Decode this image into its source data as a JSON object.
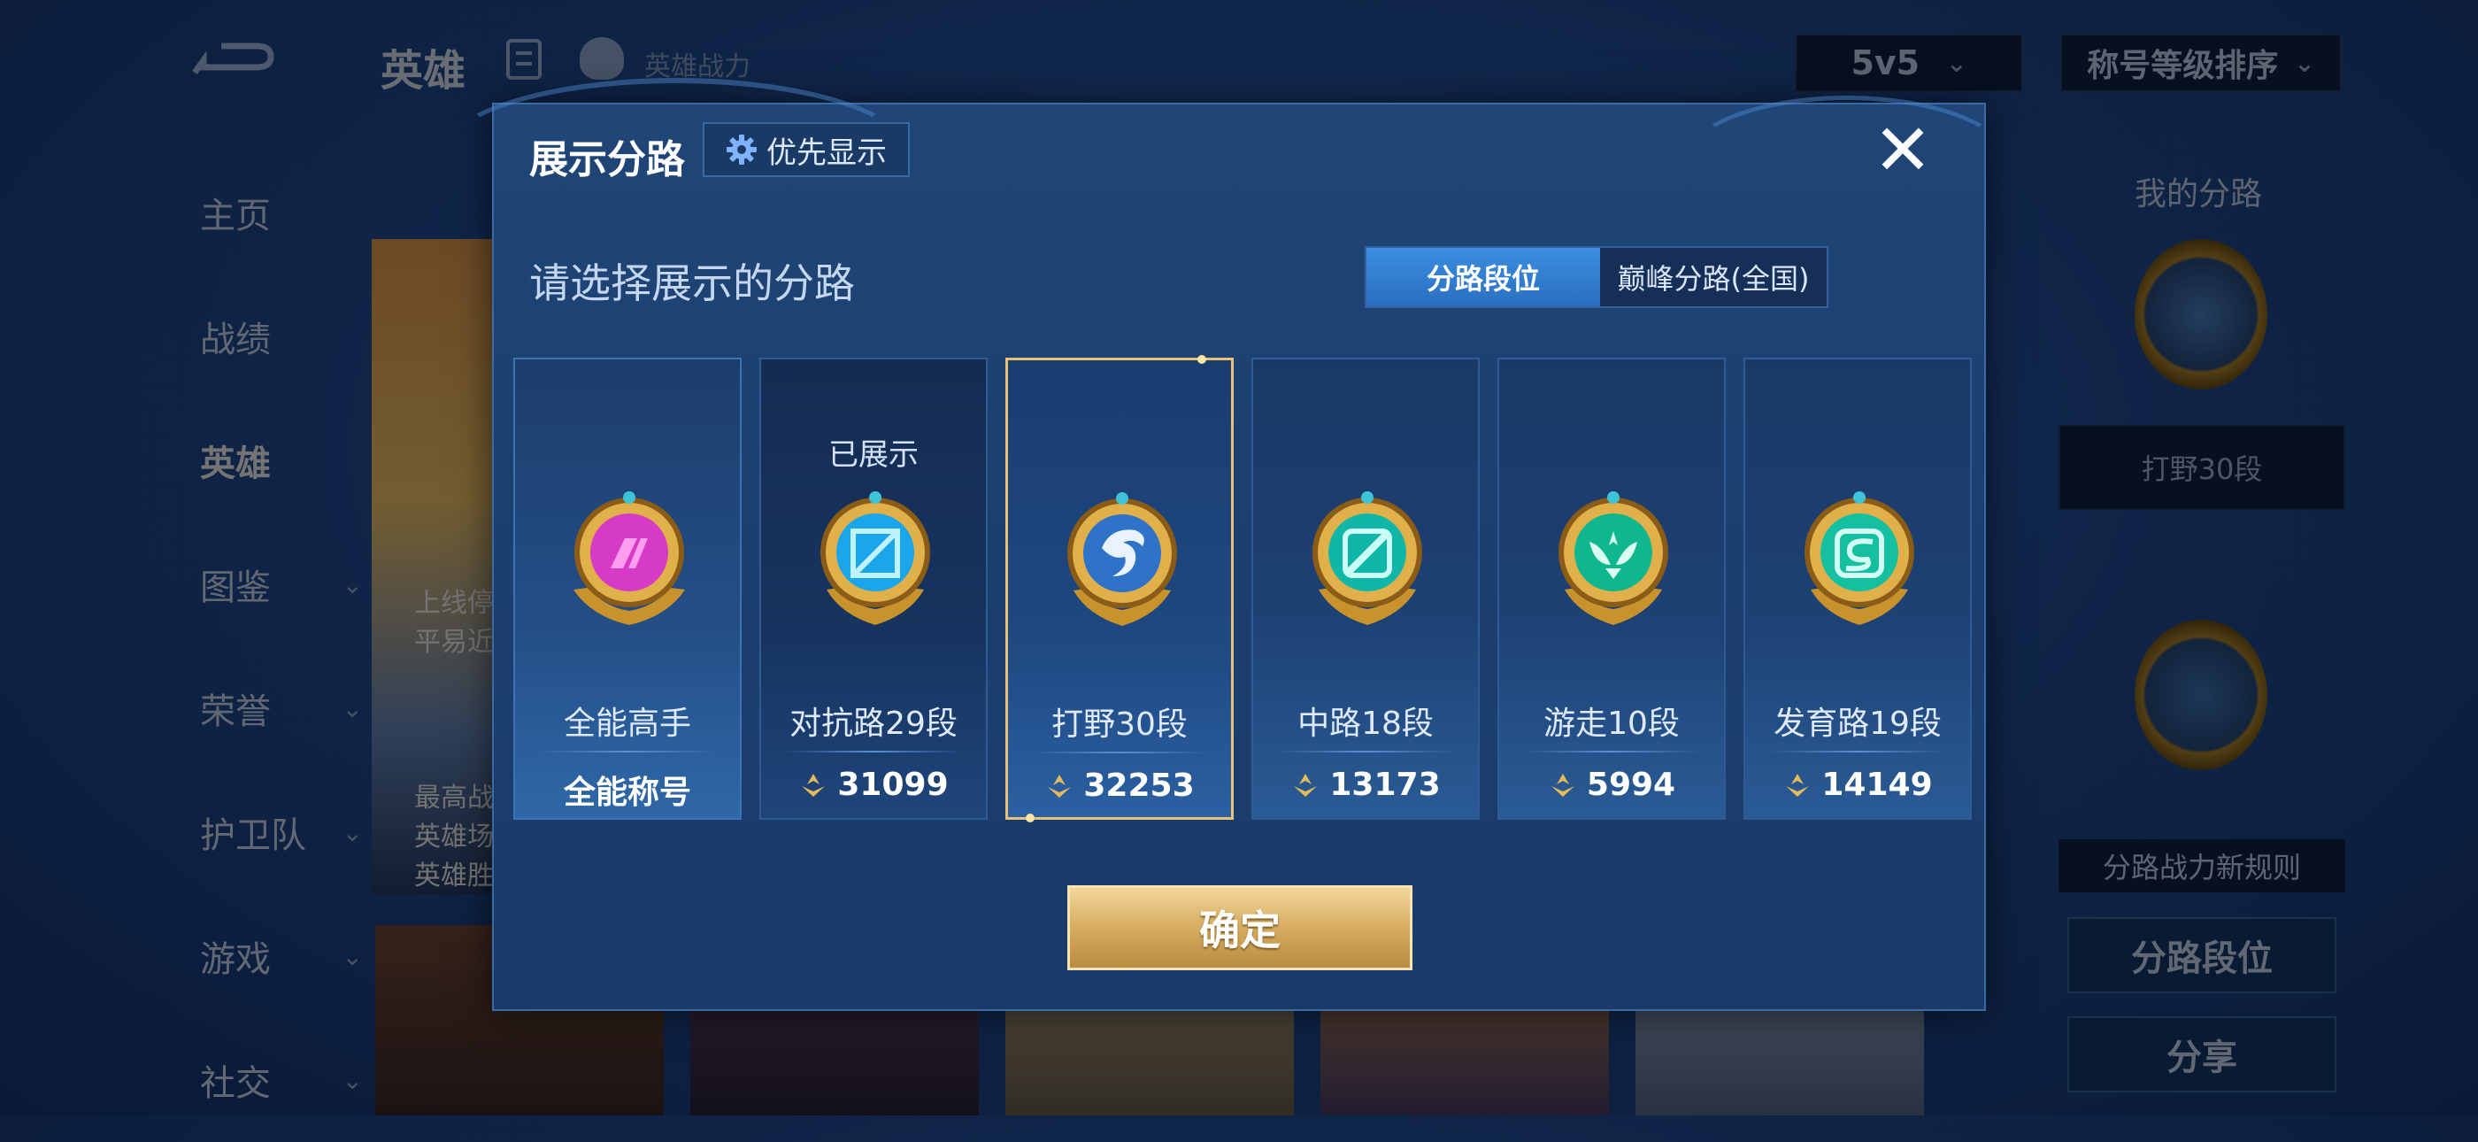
{
  "background": {
    "page_title": "英雄",
    "power_label": "英雄战力",
    "mode_select": "5v5",
    "sort_select": "称号等级排序",
    "nav": [
      {
        "label": "主页",
        "has_chevron": false
      },
      {
        "label": "战绩",
        "has_chevron": false
      },
      {
        "label": "英雄",
        "has_chevron": false,
        "active": true
      },
      {
        "label": "图鉴",
        "has_chevron": true
      },
      {
        "label": "荣誉",
        "has_chevron": true
      },
      {
        "label": "护卫队",
        "has_chevron": true
      },
      {
        "label": "游戏",
        "has_chevron": true
      },
      {
        "label": "社交",
        "has_chevron": true
      }
    ],
    "hero_card_text": [
      "最高战",
      "英雄场",
      "英雄胜"
    ],
    "hero_card_overlay": [
      "上线停",
      "平易近人"
    ],
    "right_panel": {
      "title": "我的分路",
      "current_rank": "打野30段",
      "rule_text": "分路战力新规则",
      "btn_rank": "分路段位",
      "btn_share": "分享"
    }
  },
  "modal": {
    "title": "展示分路",
    "priority_button": "优先显示",
    "section_title": "请选择展示的分路",
    "toggle": {
      "option_rank": "分路段位",
      "option_peak": "巅峰分路(全国)",
      "active": "分路段位"
    },
    "cards": [
      {
        "id": "allround",
        "shown_label": "",
        "rank": "全能高手",
        "value": "全能称号",
        "has_power_icon": false,
        "badge_color": "#d63bc6",
        "badge_inner": "#ff7ae6"
      },
      {
        "id": "clash",
        "shown_label": "已展示",
        "rank": "对抗路29段",
        "value": "31099",
        "has_power_icon": true,
        "badge_color": "#1aa6e8",
        "badge_inner": "#7fe0ff"
      },
      {
        "id": "jungle",
        "shown_label": "",
        "rank": "打野30段",
        "value": "32253",
        "has_power_icon": true,
        "badge_color": "#2f73c9",
        "badge_inner": "#cfe6ff",
        "selected": true
      },
      {
        "id": "mid",
        "shown_label": "",
        "rank": "中路18段",
        "value": "13173",
        "has_power_icon": true,
        "badge_color": "#10b7a8",
        "badge_inner": "#7ff5e4"
      },
      {
        "id": "roam",
        "shown_label": "",
        "rank": "游走10段",
        "value": "5994",
        "has_power_icon": true,
        "badge_color": "#10b78e",
        "badge_inner": "#9bffd8"
      },
      {
        "id": "farm",
        "shown_label": "",
        "rank": "发育路19段",
        "value": "14149",
        "has_power_icon": true,
        "badge_color": "#14c0a0",
        "badge_inner": "#a5ffe8"
      }
    ],
    "confirm_button": "确定"
  },
  "colors": {
    "accent_gold": "#d9b066",
    "toggle_active": "#2f7fd0",
    "modal_bg": "#1d4273"
  }
}
